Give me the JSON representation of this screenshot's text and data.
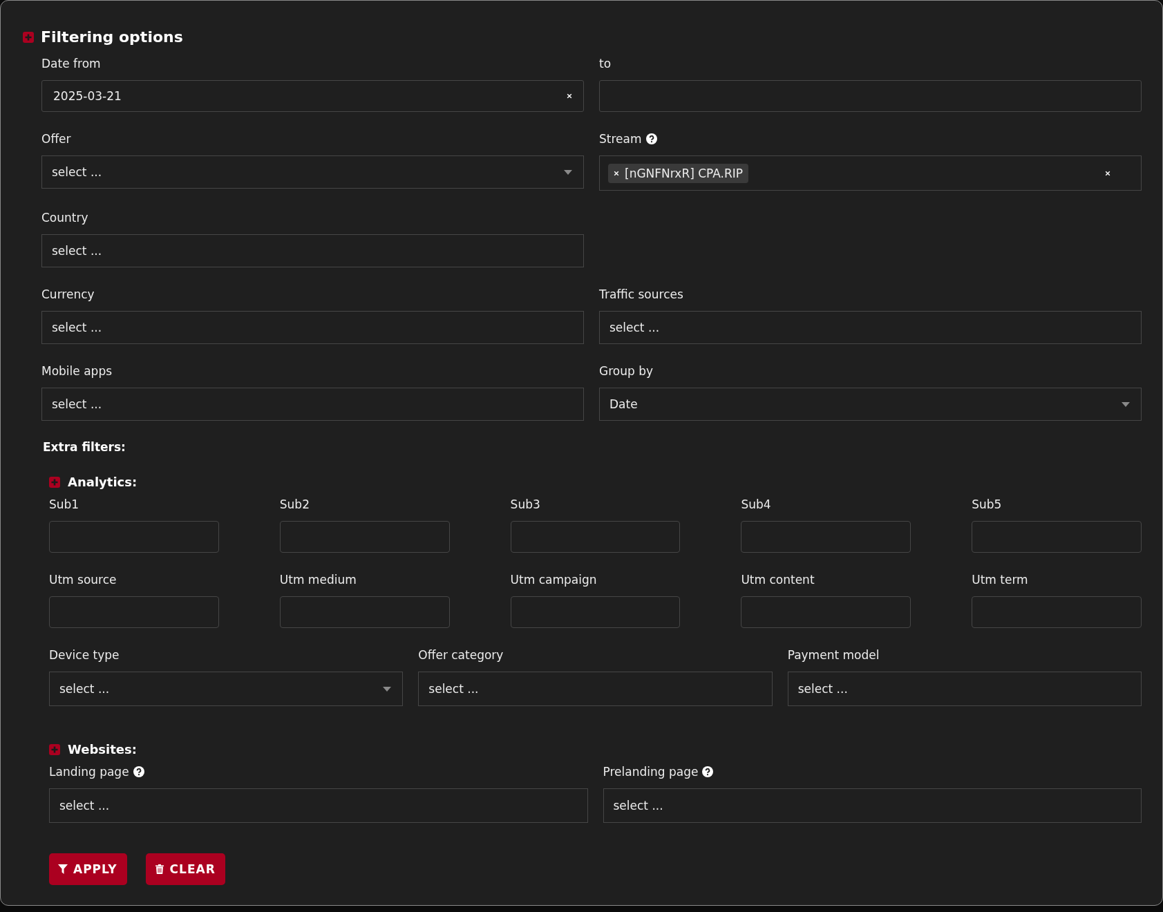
{
  "panel": {
    "title": "Filtering options",
    "rows": [
      [
        {
          "label": "Date from",
          "kind": "date",
          "value": "2025-03-21",
          "clearable": true
        },
        {
          "label": "to",
          "kind": "date",
          "clearable": false
        }
      ],
      [
        {
          "label": "Offer",
          "kind": "select",
          "placeholder": "select ...",
          "dropdown_arrow": true
        },
        {
          "label": "Stream",
          "help": true,
          "kind": "tags",
          "tags": [
            "[nGNFNrxR] CPA.RIP"
          ],
          "clearable": true
        }
      ],
      [
        {
          "label": "Country",
          "kind": "select",
          "placeholder": "select ...",
          "dropdown_arrow": false
        }
      ],
      [
        {
          "label": "Currency",
          "kind": "select",
          "placeholder": "select ...",
          "dropdown_arrow": false
        },
        {
          "label": "Traffic sources",
          "kind": "select",
          "placeholder": "select ...",
          "dropdown_arrow": false
        }
      ],
      [
        {
          "label": "Mobile apps",
          "kind": "select",
          "placeholder": "select ...",
          "dropdown_arrow": false
        },
        {
          "label": "Group by",
          "kind": "select",
          "value": "Date",
          "dropdown_arrow": true
        }
      ]
    ],
    "extra_title": "Extra filters:",
    "sections": [
      {
        "title": "Analytics:",
        "rows": [
          [
            {
              "label": "Sub1",
              "kind": "text"
            },
            {
              "label": "Sub2",
              "kind": "text"
            },
            {
              "label": "Sub3",
              "kind": "text"
            },
            {
              "label": "Sub4",
              "kind": "text"
            },
            {
              "label": "Sub5",
              "kind": "text"
            }
          ],
          [
            {
              "label": "Utm source",
              "kind": "text"
            },
            {
              "label": "Utm medium",
              "kind": "text"
            },
            {
              "label": "Utm campaign",
              "kind": "text"
            },
            {
              "label": "Utm content",
              "kind": "text"
            },
            {
              "label": "Utm term",
              "kind": "text"
            }
          ],
          [
            {
              "label": "Device type",
              "kind": "select",
              "placeholder": "select ...",
              "dropdown_arrow": true
            },
            {
              "label": "Offer category",
              "kind": "select",
              "placeholder": "select ...",
              "dropdown_arrow": false
            },
            {
              "label": "Payment model",
              "kind": "select",
              "placeholder": "select ...",
              "dropdown_arrow": false
            }
          ]
        ]
      },
      {
        "title": "Websites:",
        "rows": [
          [
            {
              "label": "Landing page",
              "help": true,
              "kind": "select",
              "placeholder": "select ...",
              "dropdown_arrow": false
            },
            {
              "label": "Prelanding page",
              "help": true,
              "kind": "select",
              "placeholder": "select ...",
              "dropdown_arrow": false
            }
          ]
        ]
      }
    ],
    "buttons": [
      {
        "label": "APPLY",
        "kind": "filter"
      },
      {
        "label": "CLEAR",
        "kind": "trash"
      }
    ]
  }
}
